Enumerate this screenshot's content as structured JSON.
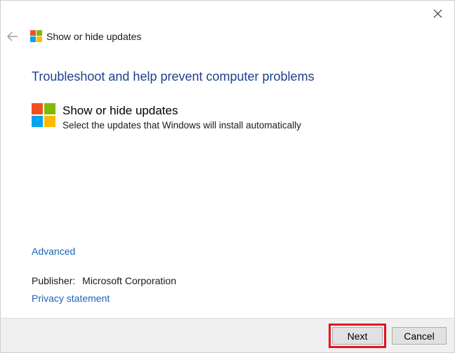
{
  "window": {
    "title": "Show or hide updates"
  },
  "main": {
    "heading": "Troubleshoot and help prevent computer problems",
    "item": {
      "title": "Show or hide updates",
      "description": "Select the updates that Windows will install automatically"
    },
    "advanced_link": "Advanced",
    "publisher": {
      "label": "Publisher:",
      "value": "Microsoft Corporation"
    },
    "privacy_link": "Privacy statement"
  },
  "footer": {
    "next_label": "Next",
    "cancel_label": "Cancel"
  },
  "icons": {
    "close": "close-icon",
    "back": "back-arrow-icon",
    "logo": "windows-logo-icon"
  },
  "colors": {
    "heading": "#1f3f8f",
    "link": "#1b64b8",
    "highlight": "#e81123",
    "logo_red": "#f25022",
    "logo_green": "#7fba00",
    "logo_blue": "#00a4ef",
    "logo_yellow": "#ffb900"
  }
}
